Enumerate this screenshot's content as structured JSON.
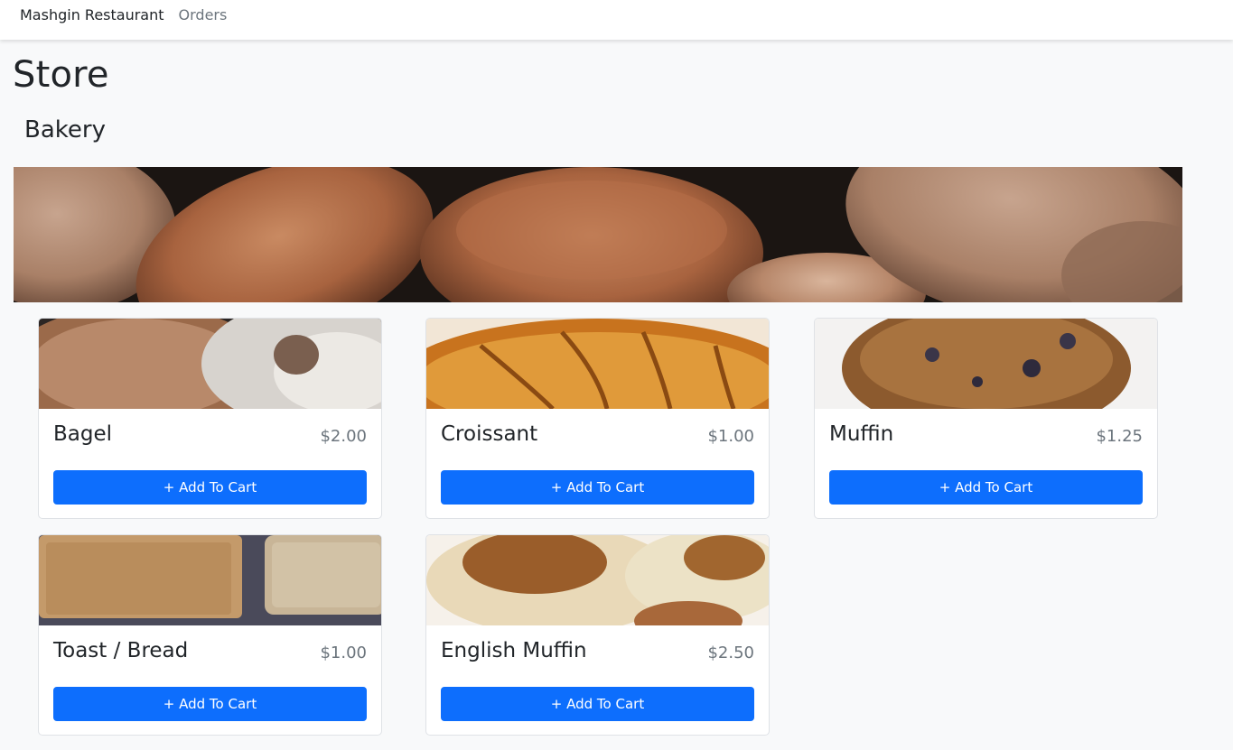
{
  "navbar": {
    "brand": "Mashgin Restaurant",
    "orders_link": "Orders"
  },
  "page_title": "Store",
  "category": {
    "title": "Bakery"
  },
  "products": [
    {
      "name": "Bagel",
      "price": "$2.00",
      "button_label": "+ Add To Cart"
    },
    {
      "name": "Croissant",
      "price": "$1.00",
      "button_label": "+ Add To Cart"
    },
    {
      "name": "Muffin",
      "price": "$1.25",
      "button_label": "+ Add To Cart"
    },
    {
      "name": "Toast / Bread",
      "price": "$1.00",
      "button_label": "+ Add To Cart"
    },
    {
      "name": "English Muffin",
      "price": "$2.50",
      "button_label": "+ Add To Cart"
    }
  ],
  "colors": {
    "primary_button": "#0d6efd",
    "price_text": "#6c757d",
    "page_background": "#f8f9fa"
  }
}
